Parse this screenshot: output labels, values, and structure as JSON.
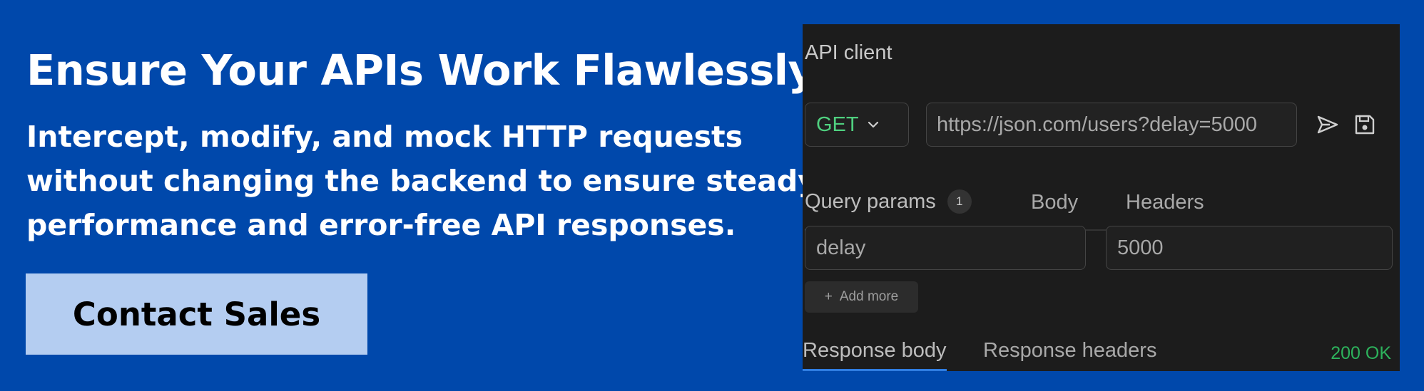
{
  "banner": {
    "headline": "Ensure Your APIs Work Flawlessly",
    "subtext_lines": [
      "Intercept, modify, and mock HTTP requests",
      "without changing the backend to ensure steady",
      "performance and error-free API responses."
    ],
    "cta_label": "Contact Sales",
    "colors": {
      "background": "#0048ab",
      "cta_background": "#b4cdf1"
    }
  },
  "api_client": {
    "title": "API client",
    "method": "GET",
    "url": "https://json.com/users?delay=5000",
    "send_icon": "send-icon",
    "save_icon": "save-icon",
    "tabs": [
      {
        "label": "Query params",
        "badge": "1",
        "active": true
      },
      {
        "label": "Body"
      },
      {
        "label": "Headers"
      }
    ],
    "params": [
      {
        "key": "delay",
        "value": "5000"
      }
    ],
    "add_more_label": "Add more",
    "response_tabs": [
      {
        "label": "Response body",
        "active": true
      },
      {
        "label": "Response headers"
      }
    ],
    "status": "200 OK",
    "colors": {
      "panel": "#1c1c1c",
      "method": "#4fd07f",
      "status": "#2db25c",
      "active_tab": "#2f7de1"
    }
  }
}
